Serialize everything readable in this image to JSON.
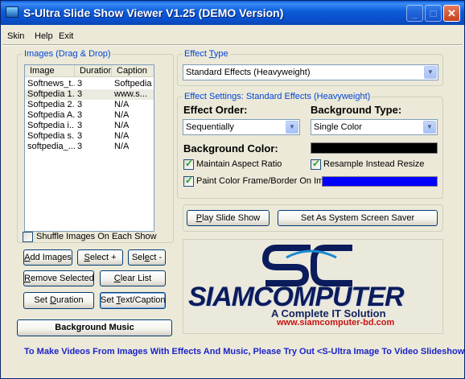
{
  "window": {
    "title": "S-Ultra Slide Show Viewer V1.25 (DEMO Version)",
    "controls": {
      "minimize": "_",
      "maximize": "□",
      "close": "✕"
    }
  },
  "menu": {
    "skin": "Skin",
    "help": "Help",
    "exit": "Exit"
  },
  "images_panel": {
    "title": "Images (Drag & Drop)",
    "columns": [
      "Image",
      "Duration",
      "Caption"
    ],
    "rows": [
      {
        "image": "Softnews_t...",
        "duration": "3",
        "caption": "Softpedia"
      },
      {
        "image": "Softpedia 1...",
        "duration": "3",
        "caption": "www.s..."
      },
      {
        "image": "Softpedia 2...",
        "duration": "3",
        "caption": "N/A"
      },
      {
        "image": "Softpedia A...",
        "duration": "3",
        "caption": "N/A"
      },
      {
        "image": "Softpedia i...",
        "duration": "3",
        "caption": "N/A"
      },
      {
        "image": "Softpedia s...",
        "duration": "3",
        "caption": "N/A"
      },
      {
        "image": "softpedia_...",
        "duration": "3",
        "caption": "N/A"
      }
    ],
    "selected_row": 1,
    "shuffle_label": "Shuffle Images On Each Show",
    "shuffle_checked": false
  },
  "buttons": {
    "add_images": {
      "underline": "A",
      "rest": "dd Images"
    },
    "select_plus": {
      "underline": "S",
      "rest": "elect +"
    },
    "select_minus": {
      "pre": "Sel",
      "underline": "e",
      "rest": "ct -"
    },
    "remove_selected": {
      "underline": "R",
      "rest": "emove Selected"
    },
    "clear_list": {
      "pre": "",
      "underline": "C",
      "rest": "lear List"
    },
    "set_duration": {
      "pre": "Set ",
      "underline": "D",
      "rest": "uration"
    },
    "set_text_caption": {
      "pre": "Set ",
      "underline": "T",
      "rest": "ext/Caption"
    },
    "background_music": "Background Music",
    "play_slide_show": {
      "pre": "",
      "underline": "P",
      "rest": "lay Slide Show"
    },
    "set_screensaver": "Set As  System Screen Saver"
  },
  "effect_type": {
    "title": "Effect Type",
    "title_underline": "T",
    "title_pre": "Effect ",
    "title_rest": "ype",
    "value": "Standard Effects (Heavyweight)"
  },
  "effect_settings": {
    "title": "Effect Settings: Standard Effects (Heavyweight)",
    "effect_order_label": "Effect Order:",
    "effect_order_value": "Sequentially",
    "background_type_label": "Background Type:",
    "background_type_value": "Single Color",
    "background_color_label": "Background Color:",
    "background_color": "#000000",
    "maintain_aspect_label": "Maintain Aspect Ratio",
    "maintain_aspect_checked": true,
    "resample_label": "Resample Instead Resize",
    "resample_checked": true,
    "paint_frame_label": "Paint Color Frame/Border On Image:",
    "paint_frame_checked": true,
    "frame_color": "#0000ff"
  },
  "logo": {
    "word": "SIAMCOMPUTER",
    "tagline": "A Complete IT Solution",
    "url": "www.siamcomputer-bd.com",
    "accent": "#0b1c5c",
    "url_color": "#c81313"
  },
  "footer": {
    "promo_text": "To Make Videos From Images With Effects And Music, Please Try Out <S-Ultra Image To Video Slideshow>"
  }
}
